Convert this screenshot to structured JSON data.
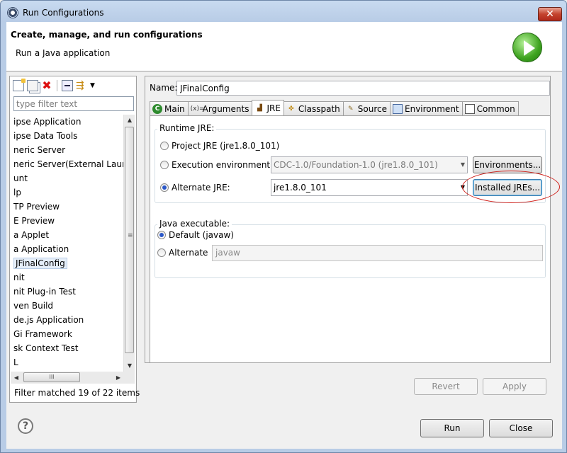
{
  "window": {
    "title": "Run Configurations",
    "close_glyph": "✕"
  },
  "header": {
    "title": "Create, manage, and run configurations",
    "subtitle": "Run a Java application",
    "logo_icon": "run-icon"
  },
  "left": {
    "toolbar": {
      "icons": [
        "new-config-icon",
        "duplicate-icon",
        "delete-icon",
        "collapse-all-icon",
        "filter-icon",
        "view-menu-icon"
      ],
      "delete_glyph": "✖",
      "filter_glyph": "⇶",
      "menu_glyph": "▼"
    },
    "filter_placeholder": "type filter text",
    "tree": [
      "ipse Application",
      "ipse Data Tools",
      "neric Server",
      "neric Server(External Launc",
      "unt",
      "lp",
      "TP Preview",
      "E Preview",
      "a Applet",
      "a Application",
      "JFinalConfig",
      "nit",
      "nit Plug-in Test",
      "ven Build",
      "de.js Application",
      "Gi Framework",
      "sk Context Test",
      "L"
    ],
    "selected_index": 10,
    "scroll": {
      "up": "▲",
      "down": "▼",
      "left": "◀",
      "right": "▶",
      "hgrip": "III",
      "vgrip": "≡"
    },
    "status": "Filter matched 19 of 22 items"
  },
  "right": {
    "name_label": "Name:",
    "name_value": "JFinalConfig",
    "tabs": [
      {
        "label": "Main",
        "icon": "main-tab-icon",
        "glyph": "C"
      },
      {
        "label": "Arguments",
        "icon": "arguments-tab-icon",
        "glyph": "(x)="
      },
      {
        "label": "JRE",
        "icon": "jre-tab-icon",
        "glyph": "▟"
      },
      {
        "label": "Classpath",
        "icon": "classpath-tab-icon",
        "glyph": "✤"
      },
      {
        "label": "Source",
        "icon": "source-tab-icon",
        "glyph": "✎"
      },
      {
        "label": "Environment",
        "icon": "environment-tab-icon",
        "glyph": ""
      },
      {
        "label": "Common",
        "icon": "common-tab-icon",
        "glyph": ""
      }
    ],
    "active_tab": "JRE",
    "runtime": {
      "group_label": "Runtime JRE:",
      "project_label": "Project JRE (jre1.8.0_101)",
      "exec_env_label": "Execution environment:",
      "exec_env_value": "CDC-1.0/Foundation-1.0 (jre1.8.0_101)",
      "environments_button": "Environments...",
      "alternate_label": "Alternate JRE:",
      "alternate_value": "jre1.8.0_101",
      "installed_button": "Installed JREs...",
      "selected": "alternate",
      "dropdown_arrow": "▼"
    },
    "executable": {
      "group_label": "Java executable:",
      "default_label": "Default (javaw)",
      "alternate_label": "Alternate",
      "alternate_value": "javaw",
      "selected": "default"
    },
    "revert_button": "Revert",
    "apply_button": "Apply"
  },
  "footer": {
    "help_glyph": "?",
    "run_button": "Run",
    "close_button": "Close"
  },
  "colors": {
    "annotation_ellipse": "#d0201a",
    "selection": "#e5eef9"
  }
}
